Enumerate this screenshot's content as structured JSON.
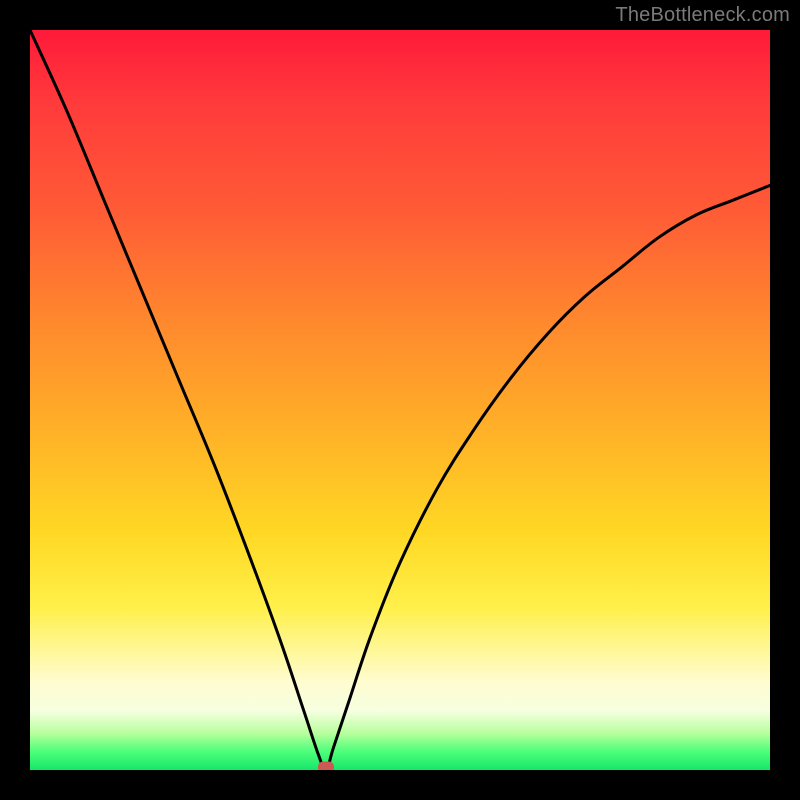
{
  "watermark": {
    "text": "TheBottleneck.com"
  },
  "colors": {
    "frame": "#000000",
    "curve": "#000000",
    "marker": "#cc5a54",
    "gradient_top": "#ff1a3a",
    "gradient_bottom": "#15e66a"
  },
  "chart_data": {
    "type": "line",
    "title": "",
    "xlabel": "",
    "ylabel": "",
    "xlim": [
      0,
      100
    ],
    "ylim": [
      0,
      100
    ],
    "grid": false,
    "legend": false,
    "comment": "V-shaped bottleneck curve; minimum near x≈40 y≈0; marker at minimum. Values estimated from pixels.",
    "series": [
      {
        "name": "bottleneck-curve",
        "x": [
          0,
          5,
          10,
          15,
          20,
          25,
          30,
          34,
          37,
          39,
          40,
          41,
          43,
          46,
          50,
          55,
          60,
          65,
          70,
          75,
          80,
          85,
          90,
          95,
          100
        ],
        "values": [
          100,
          89,
          77,
          65,
          53,
          41,
          28,
          17,
          8,
          2,
          0,
          3,
          9,
          18,
          28,
          38,
          46,
          53,
          59,
          64,
          68,
          72,
          75,
          77,
          79
        ]
      }
    ],
    "marker": {
      "x": 40,
      "y": 0
    }
  }
}
